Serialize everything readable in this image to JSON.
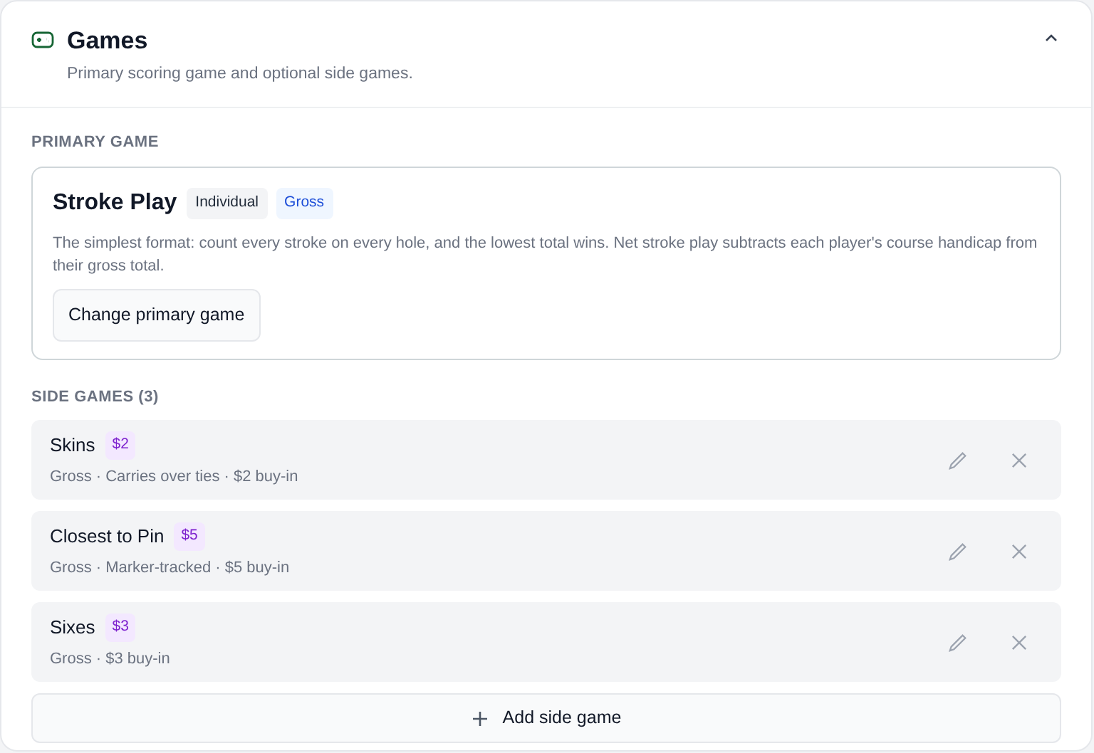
{
  "section": {
    "title": "Games",
    "subtitle": "Primary scoring game and optional side games.",
    "expanded": true
  },
  "primary_game": {
    "heading": "PRIMARY GAME",
    "name": "Stroke Play",
    "badges": [
      {
        "label": "Individual",
        "kind": "neutral"
      },
      {
        "label": "Gross",
        "kind": "info"
      }
    ],
    "description": "The simplest format: count every stroke on every hole, and the lowest total wins. Net stroke play subtracts each player's course handicap from their gross total.",
    "button": "Change primary game"
  },
  "side_games": {
    "heading": "SIDE GAMES (3)",
    "items": [
      {
        "name": "Skins",
        "badge": "$2",
        "details": "Gross · Carries over ties · $2 buy-in"
      },
      {
        "name": "Closest to Pin",
        "badge": "$5",
        "details": "Gross · Marker-tracked · $5 buy-in"
      },
      {
        "name": "Sixes",
        "badge": "$3",
        "details": "Gross · $3 buy-in"
      }
    ],
    "add_button": "Add side game"
  }
}
